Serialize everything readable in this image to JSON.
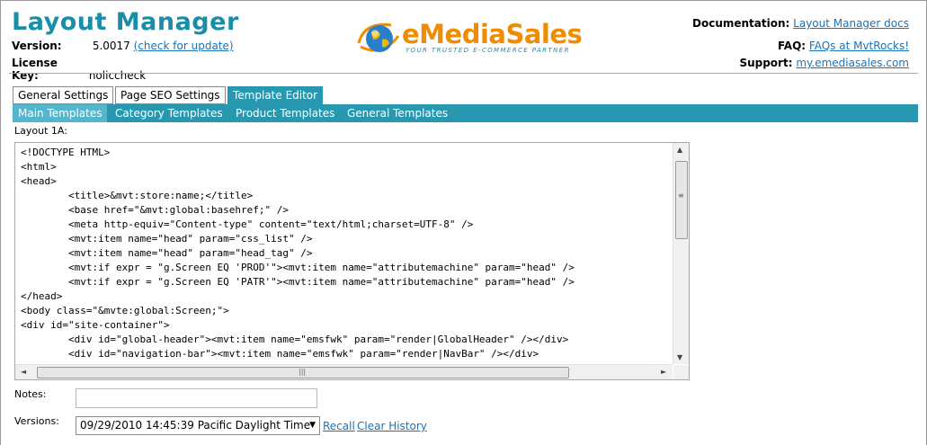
{
  "header": {
    "title": "Layout Manager",
    "version_label": "Version:",
    "version_value": "5.0017",
    "update_link": "(check for update)",
    "license_label": "License Key:",
    "license_value": "noliccheck"
  },
  "logo": {
    "text": "eMediaSales",
    "tagline": "YOUR TRUSTED E-COMMERCE PARTNER"
  },
  "links": {
    "doc_label": "Documentation:",
    "doc_link": "Layout Manager docs",
    "faq_label": "FAQ:",
    "faq_link": "FAQs at MvtRocks!",
    "support_label": "Support:",
    "support_link": "my.emediasales.com"
  },
  "tabs": [
    {
      "label": "General Settings",
      "active": false
    },
    {
      "label": "Page SEO Settings",
      "active": false
    },
    {
      "label": "Template Editor",
      "active": true
    }
  ],
  "subtabs": [
    {
      "label": "Main Templates",
      "active": true
    },
    {
      "label": "Category Templates",
      "active": false
    },
    {
      "label": "Product Templates",
      "active": false
    },
    {
      "label": "General Templates",
      "active": false
    }
  ],
  "editor": {
    "label": "Layout 1A:",
    "lines": [
      "<!DOCTYPE HTML>",
      "<html>",
      "<head>",
      "        <title>&mvt:store:name;</title>",
      "        <base href=\"&mvt:global:basehref;\" />",
      "        <meta http-equiv=\"Content-type\" content=\"text/html;charset=UTF-8\" />",
      "        <mvt:item name=\"head\" param=\"css_list\" />",
      "        <mvt:item name=\"head\" param=\"head_tag\" />",
      "        <mvt:if expr = \"g.Screen EQ 'PROD'\"><mvt:item name=\"attributemachine\" param=\"head\" />",
      "        <mvt:if expr = \"g.Screen EQ 'PATR'\"><mvt:item name=\"attributemachine\" param=\"head\" />",
      "</head>",
      "<body class=\"&mvte:global:Screen;\">",
      "<div id=\"site-container\">",
      "        <div id=\"global-header\"><mvt:item name=\"emsfwk\" param=\"render|GlobalHeader\" /></div>",
      "        <div id=\"navigation-bar\"><mvt:item name=\"emsfwk\" param=\"render|NavBar\" /></div>"
    ]
  },
  "notes": {
    "label": "Notes:",
    "value": ""
  },
  "versions": {
    "label": "Versions:",
    "selected": "09/29/2010 14:45:39 Pacific Daylight Time",
    "recall_link": "Recall",
    "clear_link": "Clear History"
  },
  "colors": {
    "title": "#1a8ea8",
    "accent_bar": "#2898b0",
    "link": "#1a73b8",
    "logo_orange": "#f08c00"
  }
}
